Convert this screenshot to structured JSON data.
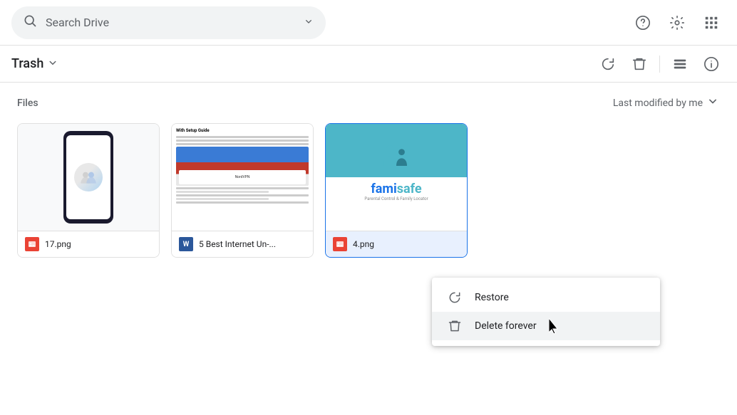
{
  "header": {
    "search_placeholder": "Search Drive",
    "help_icon": "help-circle",
    "settings_icon": "gear",
    "apps_icon": "grid"
  },
  "toolbar": {
    "title": "Trash",
    "restore_all_label": "Restore all items",
    "delete_forever_label": "Delete all items",
    "list_view_label": "Switch to list layout",
    "info_label": "View details"
  },
  "files_section": {
    "label": "Files",
    "sort_label": "Last modified by me",
    "sort_icon": "arrow-down"
  },
  "files": [
    {
      "name": "17.png",
      "type": "image",
      "icon_color": "#ea4335"
    },
    {
      "name": "5 Best Internet Un-...",
      "type": "word",
      "icon_color": "#2b579a"
    },
    {
      "name": "4.png",
      "type": "image",
      "icon_color": "#ea4335"
    }
  ],
  "context_menu": {
    "items": [
      {
        "id": "restore",
        "icon": "restore",
        "label": "Restore"
      },
      {
        "id": "delete-forever",
        "icon": "trash",
        "label": "Delete forever"
      }
    ]
  }
}
